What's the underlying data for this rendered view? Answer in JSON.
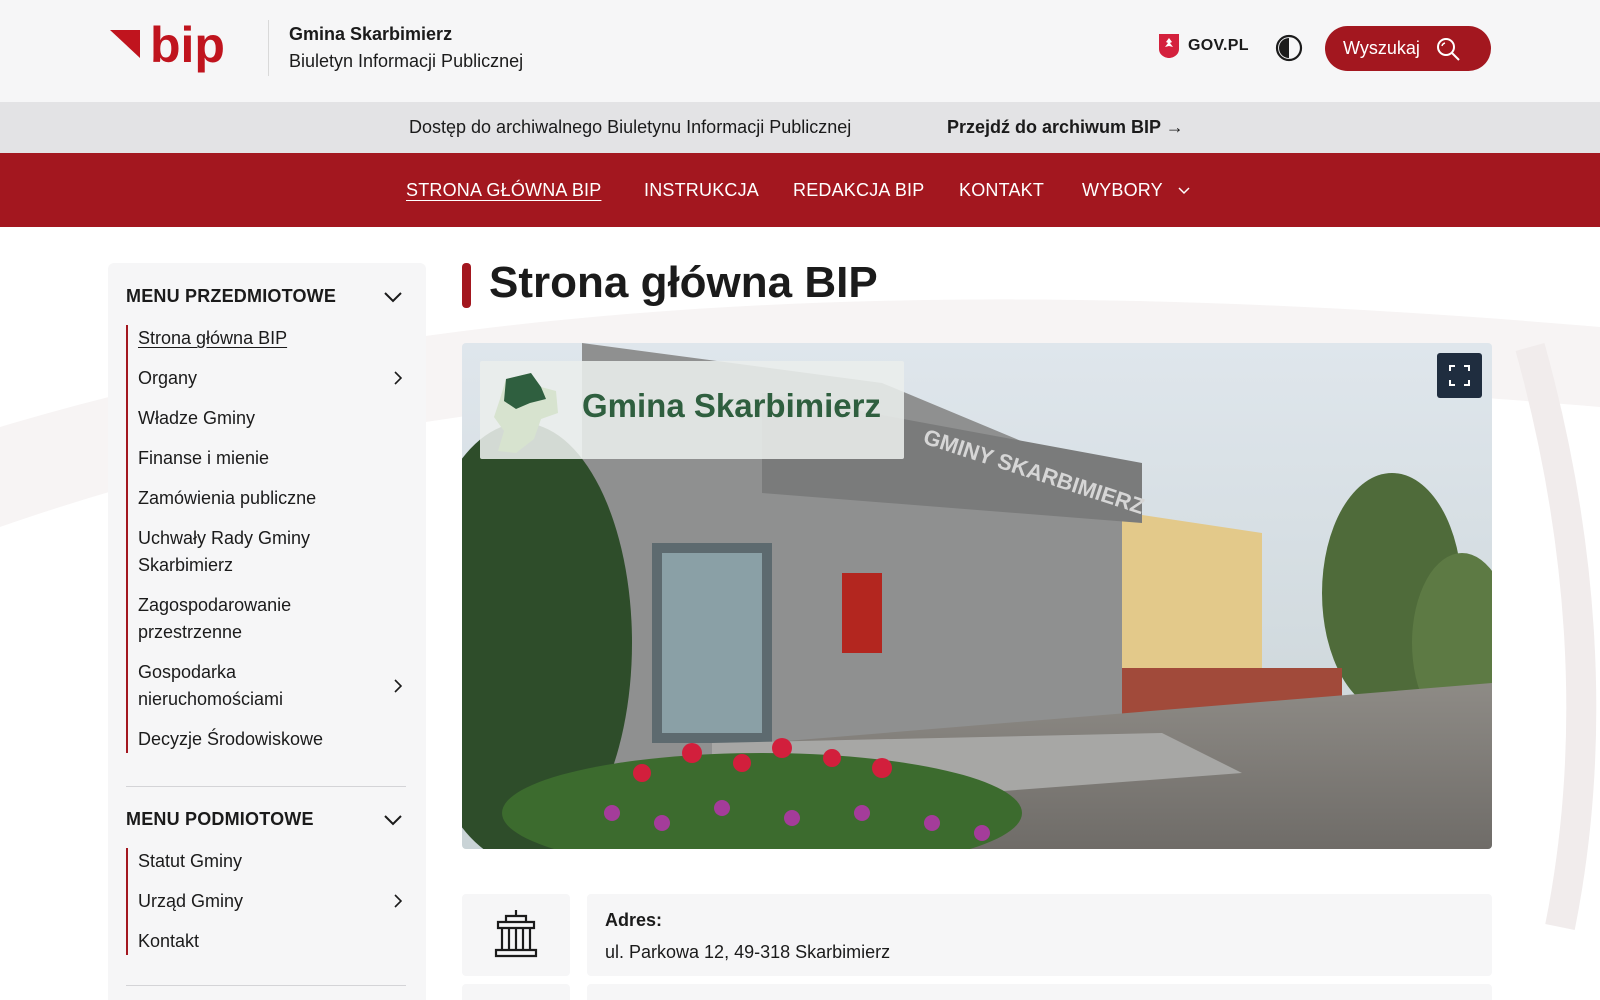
{
  "header": {
    "logo_text": "bip",
    "site_name": "Gmina Skarbimierz",
    "site_subtitle": "Biuletyn Informacji Publicznej",
    "govpl_label": "GOV.PL",
    "contrast_icon": "contrast-icon",
    "search_label": "Wyszukaj",
    "search_icon": "search-icon"
  },
  "archive": {
    "text": "Dostęp do archiwalnego Biuletynu Informacji Publicznej",
    "link": "Przejdź do archiwum BIP →"
  },
  "nav": {
    "items": [
      {
        "label": "STRONA GŁÓWNA BIP",
        "active": true
      },
      {
        "label": "INSTRUKCJA"
      },
      {
        "label": "REDAKCJA BIP"
      },
      {
        "label": "KONTAKT"
      },
      {
        "label": "WYBORY",
        "has_dropdown": true
      }
    ]
  },
  "sidebar": {
    "menu_przedmiotowe": {
      "title": "MENU PRZEDMIOTOWE",
      "items": [
        {
          "label": "Strona główna BIP",
          "active": true
        },
        {
          "label": "Organy",
          "has_submenu": true
        },
        {
          "label": "Władze Gminy"
        },
        {
          "label": "Finanse i mienie"
        },
        {
          "label": "Zamówienia publiczne"
        },
        {
          "label": "Uchwały Rady Gminy Skarbimierz"
        },
        {
          "label": "Zagospodarowanie przestrzenne"
        },
        {
          "label": "Gospodarka nieruchomościami",
          "has_submenu": true
        },
        {
          "label": "Decyzje Środowiskowe"
        }
      ]
    },
    "menu_podmiotowe": {
      "title": "MENU PODMIOTOWE",
      "items": [
        {
          "label": "Statut Gminy"
        },
        {
          "label": "Urząd Gminy",
          "has_submenu": true
        },
        {
          "label": "Kontakt"
        }
      ]
    }
  },
  "main": {
    "title": "Strona główna BIP",
    "hero_label": "Gmina Skarbimierz",
    "hero_sign": "GMINY SKARBIMIERZ",
    "info": {
      "label": "Adres:",
      "value": "ul. Parkowa 12, 49-318 Skarbimierz",
      "icon": "building-icon"
    }
  },
  "colors": {
    "brand_red": "#a3171f",
    "dark_navy": "#1f2d3f",
    "panel_bg": "#f6f6f7",
    "hero_text_green": "#2f5f3f"
  }
}
